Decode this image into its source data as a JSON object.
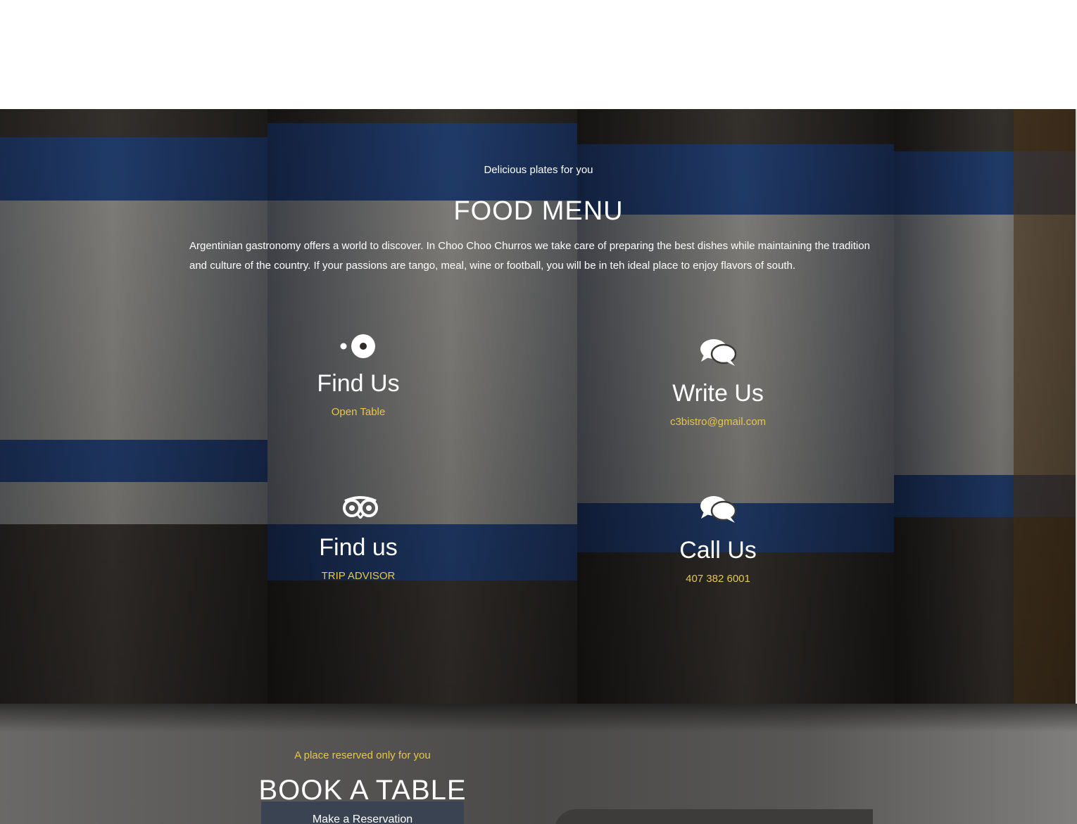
{
  "menu_section": {
    "tagline": "Delicious plates for you",
    "title": "FOOD MENU",
    "description": "Argentinian gastronomy offers a world to discover. In Choo Choo Churros we take care of preparing the best dishes while maintaining the tradition and culture of the country. If your passions are tango, meal, wine or football, you will be in teh ideal place to enjoy flavors of south."
  },
  "contacts": [
    {
      "icon": "opentable-icon",
      "heading": "Find Us",
      "link": "Open Table"
    },
    {
      "icon": "comments-icon",
      "heading": "Write Us",
      "link": "c3bistro@gmail.com"
    },
    {
      "icon": "tripadvisor-icon",
      "heading": "Find us",
      "link": "TRIP ADVISOR"
    },
    {
      "icon": "comments-icon",
      "heading": "Call Us",
      "link": "407 382 6001"
    }
  ],
  "booking": {
    "tagline": "A place reserved only for you",
    "title": "BOOK A TABLE",
    "button_label": "Make a Reservation"
  },
  "colors": {
    "accent": "#e8c64a",
    "button_bg": "#3a4352"
  }
}
